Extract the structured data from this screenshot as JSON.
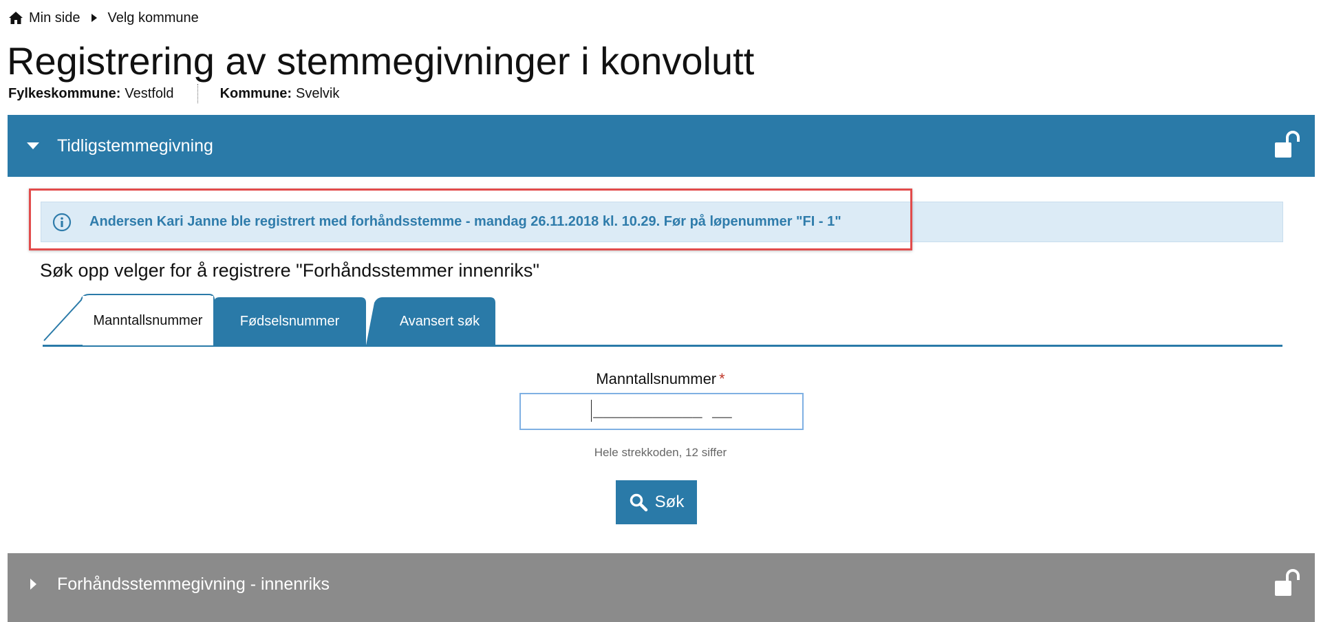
{
  "breadcrumb": {
    "home_label": "Min side",
    "current_label": "Velg kommune"
  },
  "page": {
    "title": "Registrering av stemmegivninger i konvolutt",
    "county_label": "Fylkeskommune:",
    "county_value": "Vestfold",
    "municipality_label": "Kommune:",
    "municipality_value": "Svelvik"
  },
  "panels": [
    {
      "title": "Tidligstemmegivning",
      "state": "expanded",
      "color": "#2a7aa8",
      "icon": "unlock-icon"
    },
    {
      "title": "Forhåndsstemmegivning - innenriks",
      "state": "collapsed",
      "color": "#8b8b8b",
      "icon": "unlock-icon"
    }
  ],
  "alert": {
    "icon": "info-icon",
    "text": "Andersen Kari Janne ble registrert med forhåndsstemme - mandag 26.11.2018 kl. 10.29. Før på løpenummer \"FI - 1\"",
    "highlight_color": "#e24b4b"
  },
  "search": {
    "heading": "Søk opp velger for å registrere \"Forhåndsstemmer innenriks\"",
    "tabs": [
      {
        "label": "Manntallsnummer",
        "active": true
      },
      {
        "label": "Fødselsnummer",
        "active": false
      },
      {
        "label": "Avansert søk",
        "active": false
      }
    ],
    "field_label": "Manntallsnummer",
    "required_mark": "*",
    "input_value": "___________ __",
    "hint": "Hele strekkoden, 12 siffer",
    "button_label": "Søk"
  },
  "colors": {
    "primary": "#2a7aa8",
    "collapsed_panel": "#8b8b8b",
    "alert_bg": "#dcebf6",
    "alert_text": "#2f7cab"
  }
}
